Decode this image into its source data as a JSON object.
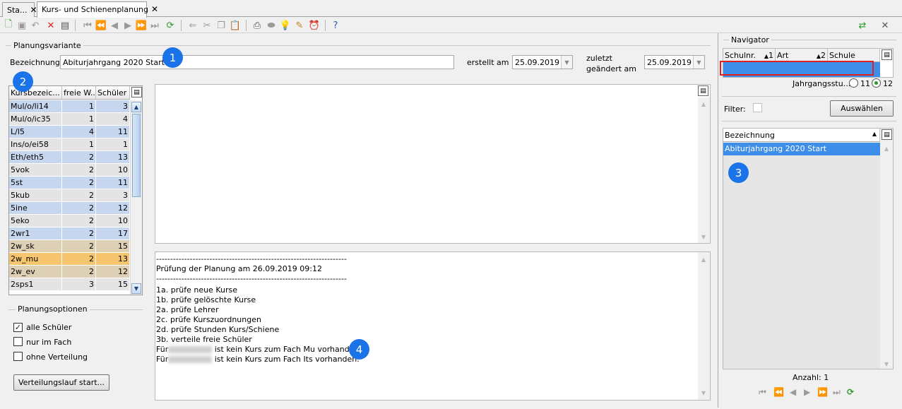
{
  "tabs": [
    {
      "label": "Sta..."
    },
    {
      "label": "Kurs- und Schienenplanung"
    }
  ],
  "planungsvariante": {
    "group_label": "Planungsvariante",
    "bezeichnung_label": "Bezeichnung",
    "bezeichnung_value": "Abiturjahrgang 2020 Start",
    "erstellt_label": "erstellt am",
    "erstellt_value": "25.09.2019",
    "geaendert_label_1": "zuletzt",
    "geaendert_label_2": "geändert am",
    "geaendert_value": "25.09.2019"
  },
  "kurs_grid": {
    "headers": [
      "Kursbezeic...",
      "freie W...",
      "Schüler"
    ],
    "rows": [
      {
        "name": "Mul/o/li14",
        "frei": "1",
        "schueler": "3",
        "color": "#c5d6ee"
      },
      {
        "name": "Mul/o/ic35",
        "frei": "1",
        "schueler": "4",
        "color": "#e4e4e4"
      },
      {
        "name": "L/l5",
        "frei": "4",
        "schueler": "11",
        "color": "#c5d6ee"
      },
      {
        "name": "Ins/o/ei58",
        "frei": "1",
        "schueler": "1",
        "color": "#e4e4e4"
      },
      {
        "name": "Eth/eth5",
        "frei": "2",
        "schueler": "13",
        "color": "#c5d6ee"
      },
      {
        "name": "5vok",
        "frei": "2",
        "schueler": "10",
        "color": "#e4e4e4"
      },
      {
        "name": "5st",
        "frei": "2",
        "schueler": "11",
        "color": "#c5d6ee"
      },
      {
        "name": "5kub",
        "frei": "2",
        "schueler": "3",
        "color": "#e4e4e4"
      },
      {
        "name": "5ine",
        "frei": "2",
        "schueler": "12",
        "color": "#c5d6ee"
      },
      {
        "name": "5eko",
        "frei": "2",
        "schueler": "10",
        "color": "#e4e4e4"
      },
      {
        "name": "2wr1",
        "frei": "2",
        "schueler": "17",
        "color": "#c5d6ee"
      },
      {
        "name": "2w_sk",
        "frei": "2",
        "schueler": "15",
        "color": "#ddd0b4"
      },
      {
        "name": "2w_mu",
        "frei": "2",
        "schueler": "13",
        "color": "#f5c66e"
      },
      {
        "name": "2w_ev",
        "frei": "2",
        "schueler": "12",
        "color": "#ddd0b4"
      },
      {
        "name": "2sps1",
        "frei": "3",
        "schueler": "15",
        "color": "#e4e4e4"
      }
    ]
  },
  "planungsoptionen": {
    "group_label": "Planungsoptionen",
    "options": [
      {
        "label": "alle Schüler",
        "checked": true
      },
      {
        "label": "nur im Fach",
        "checked": false
      },
      {
        "label": "ohne Verteilung",
        "checked": false
      }
    ],
    "start_button": "Verteilungslauf start..."
  },
  "log": {
    "separator": "--------------------------------------------------------------------",
    "title": "Prüfung der Planung am 26.09.2019 09:12",
    "steps": [
      "1a. prüfe neue Kurse",
      "1b. prüfe gelöschte Kurse",
      "2a. prüfe Lehrer",
      "2c. prüfe Kurszuordnungen",
      "2d. prüfe Stunden Kurs/Schiene",
      "3b. verteile freie Schüler"
    ],
    "msg1_prefix": "Für",
    "msg1_suffix": "ist kein Kurs zum Fach Mu vorhanden.",
    "msg2_prefix": "Für",
    "msg2_suffix": "ist kein Kurs zum Fach Its vorhanden."
  },
  "navigator": {
    "group_label": "Navigator",
    "headers": [
      "Schulnr.",
      "1",
      "Art",
      "2",
      "Schule"
    ],
    "jahrgang_label": "Jahrgangsstu...",
    "radio_11": "11",
    "radio_12": "12",
    "radio_selected": "12",
    "filter_label": "Filter:",
    "auswaehlen_button": "Auswählen",
    "list_header": "Bezeichnung",
    "list_items": [
      "Abiturjahrgang 2020 Start"
    ],
    "anzahl": "Anzahl: 1"
  },
  "badges": [
    "1",
    "2",
    "3",
    "4"
  ],
  "colors": {
    "accent": "#1a73e8",
    "selection": "#3d8ee8",
    "highlight_border": "#e02020"
  }
}
